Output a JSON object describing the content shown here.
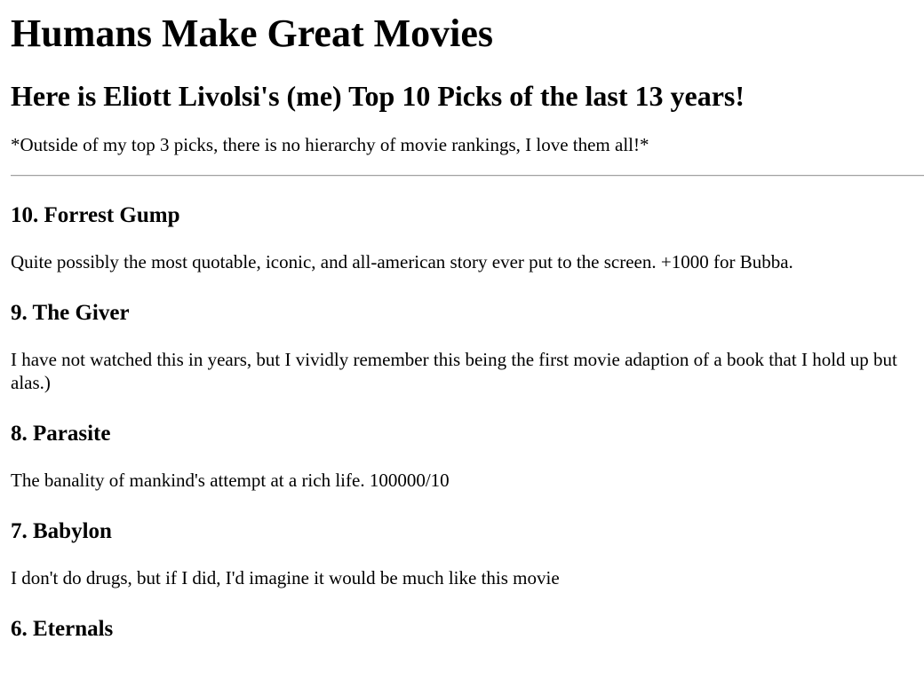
{
  "title": "Humans Make Great Movies",
  "subtitle": "Here is Eliott Livolsi's (me) Top 10 Picks of the last 13 years!",
  "note": "*Outside of my top 3 picks, there is no hierarchy of movie rankings, I love them all!*",
  "movies": [
    {
      "heading": "10. Forrest Gump",
      "description": "Quite possibly the most quotable, iconic, and all-american story ever put to the screen. +1000 for Bubba."
    },
    {
      "heading": "9. The Giver",
      "description": "I have not watched this in years, but I vividly remember this being the first movie adaption of a book that I hold up but alas.)"
    },
    {
      "heading": "8. Parasite",
      "description": "The banality of mankind's attempt at a rich life. 100000/10"
    },
    {
      "heading": "7. Babylon",
      "description": "I don't do drugs, but if I did, I'd imagine it would be much like this movie"
    },
    {
      "heading": "6. Eternals",
      "description": ""
    }
  ]
}
